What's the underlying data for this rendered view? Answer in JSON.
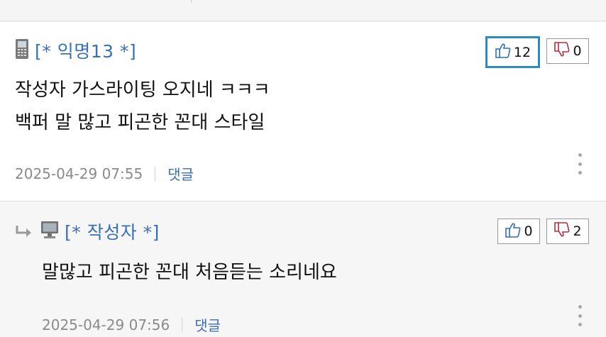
{
  "comments": [
    {
      "author": "[* 익명13 *]",
      "device_icon": "mobile-phone-icon",
      "upvotes": "12",
      "downvotes": "0",
      "upvote_active": true,
      "lines": [
        "작성자 가스라이팅 오지네 ㅋㅋㅋ",
        "백퍼 말 많고 피곤한 꼰대 스타일"
      ],
      "timestamp": "2025-04-29 07:55",
      "reply_label": "댓글"
    },
    {
      "author": "[* 작성자 *]",
      "device_icon": "desktop-computer-icon",
      "is_reply": true,
      "upvotes": "0",
      "downvotes": "2",
      "lines": [
        "말많고 피곤한 꼰대 처음듣는 소리네요"
      ],
      "timestamp": "2025-04-29 07:56",
      "reply_label": "댓글"
    }
  ],
  "colors": {
    "author": "#3a6fb5",
    "active_vote_border": "#2d8bbd",
    "meta_text": "#8a8a8a"
  }
}
